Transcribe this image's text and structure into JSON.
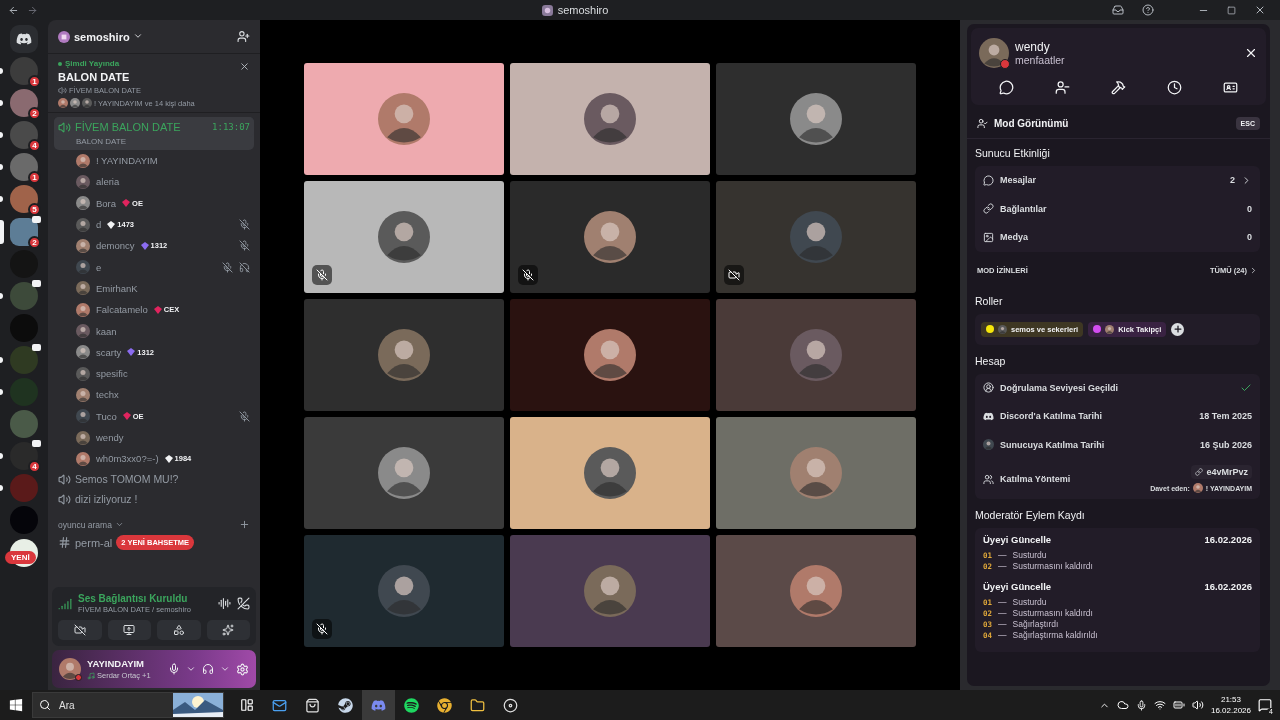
{
  "window": {
    "title": "semoshiro"
  },
  "servers": [
    {
      "unread": true,
      "selected": false,
      "badge": "1",
      "color": "#3c3c3c"
    },
    {
      "unread": true,
      "selected": false,
      "badge": "2",
      "color": "#8a6a70"
    },
    {
      "unread": true,
      "selected": false,
      "badge": "4",
      "color": "#4a4a4a"
    },
    {
      "unread": true,
      "selected": false,
      "badge": "1",
      "color": "#6a6a6a"
    },
    {
      "unread": true,
      "selected": false,
      "badge": "5",
      "color": "#a0634a"
    },
    {
      "unread": false,
      "selected": true,
      "badge": "2",
      "activity": true,
      "color": "#5d7d96"
    },
    {
      "unread": false,
      "selected": false,
      "color": "#141414"
    },
    {
      "unread": true,
      "selected": false,
      "activity": true,
      "color": "#3d4a3a"
    },
    {
      "unread": false,
      "selected": false,
      "color": "#0c0c0c"
    },
    {
      "unread": true,
      "selected": false,
      "activity": true,
      "color": "#2f3a22"
    },
    {
      "unread": true,
      "selected": false,
      "color": "#1f3320"
    },
    {
      "unread": false,
      "selected": false,
      "color": "#4a5a48"
    },
    {
      "unread": true,
      "selected": false,
      "badge": "4",
      "activity": true,
      "color": "#2a2a2a"
    },
    {
      "unread": true,
      "selected": false,
      "color": "#5a1a1a"
    },
    {
      "unread": false,
      "selected": false,
      "color": "#05050a"
    },
    {
      "unread": false,
      "selected": false,
      "pill": "YENİ",
      "color": "#e8efe6"
    }
  ],
  "server": {
    "name": "semoshiro"
  },
  "live": {
    "label": "Şimdi Yayında",
    "title": "BALON DATE",
    "channel": "FİVEM BALON DATE",
    "viewers": "! YAYINDAYIM ve 14 kişi daha"
  },
  "channels": [
    {
      "kind": "voice",
      "name": "FİVEM BALON DATE",
      "selected": true,
      "timer": "1:13:07",
      "status": "BALON DATE",
      "members": [
        {
          "name": "! YAYINDAYIM"
        },
        {
          "name": "aleria"
        },
        {
          "name": "Bora",
          "tag": {
            "text": "OE",
            "color": "#e0245e"
          }
        },
        {
          "name": "d",
          "tag": {
            "text": "1473",
            "color": "#f2f3f5"
          },
          "muted": true
        },
        {
          "name": "demoncy",
          "tag": {
            "text": "1312",
            "color": "#8b6cf0"
          },
          "muted": true
        },
        {
          "name": "e",
          "muted": true,
          "deafened": true
        },
        {
          "name": "EmirhanK"
        },
        {
          "name": "Falcatamelo",
          "tag": {
            "text": "CEX",
            "color": "#e0245e"
          }
        },
        {
          "name": "kaan"
        },
        {
          "name": "scarty",
          "tag": {
            "text": "1312",
            "color": "#8b6cf0"
          }
        },
        {
          "name": "spesific"
        },
        {
          "name": "techx"
        },
        {
          "name": "Tuco",
          "tag": {
            "text": "OE",
            "color": "#e0245e"
          },
          "muted": true
        },
        {
          "name": "wendy"
        },
        {
          "name": "wh0m3xx0?=-)",
          "tag": {
            "text": "1984",
            "color": "#f2f3f5"
          }
        }
      ]
    },
    {
      "kind": "voice",
      "name": "Semos TOMOM MU!?",
      "selected": false
    },
    {
      "kind": "voice",
      "name": "dizi izliyoruz !",
      "selected": false
    },
    {
      "kind": "category",
      "name": "oyuncu arama",
      "selected": false
    },
    {
      "kind": "text",
      "name": "perm-al",
      "selected": false,
      "mention_pill": "2 YENİ BAHSETME"
    }
  ],
  "voice_panel": {
    "status": "Ses Bağlantısı Kuruldu",
    "detail": "FİVEM BALON DATE / semoshiro"
  },
  "user": {
    "name": "YAYINDAYIM",
    "activity": "Serdar Ortaç +1",
    "do_not_disturb": true
  },
  "video_tiles": [
    {
      "color": "#eeaaaf"
    },
    {
      "color": "#c4b2ad"
    },
    {
      "color": "#2e2e2e"
    },
    {
      "color": "#b8b8b8",
      "muted": true
    },
    {
      "color": "#2a2a2a",
      "muted": true
    },
    {
      "color": "#36332f",
      "video_off": true
    },
    {
      "color": "#2e2e2e"
    },
    {
      "color": "#2a1210"
    },
    {
      "color": "#4a3a38"
    },
    {
      "color": "#3a3a3a"
    },
    {
      "color": "#d9b28a"
    },
    {
      "color": "#6e6e66"
    },
    {
      "color": "#1f2a30",
      "muted": true
    },
    {
      "color": "#4a3a50"
    },
    {
      "color": "#5b4a48"
    }
  ],
  "profile": {
    "name": "wendy",
    "subtitle": "menfaatler",
    "do_not_disturb": true
  },
  "mod_view": {
    "title": "Mod Görünümü",
    "key": "ESC"
  },
  "server_activity": {
    "title": "Sunucu Etkinliği",
    "rows": [
      {
        "kind": "messages",
        "label": "Mesajlar",
        "value": "2",
        "link": true
      },
      {
        "kind": "links",
        "label": "Bağlantılar",
        "value": "0"
      },
      {
        "kind": "media",
        "label": "Medya",
        "value": "0"
      }
    ]
  },
  "mod_permissions": {
    "label": "MOD İZİNLERİ",
    "action": "TÜMÜ (24)"
  },
  "roles": {
    "title": "Roller",
    "items": [
      {
        "name": "semos ve sekerleri",
        "color": "#f5e60a"
      },
      {
        "name": "Kick Takipçi",
        "color": "#d24df0"
      }
    ]
  },
  "account": {
    "title": "Hesap",
    "rows": [
      {
        "kind": "verification",
        "label": "Doğrulama Seviyesi Geçildi",
        "verified": true
      },
      {
        "kind": "discord_join",
        "label": "Discord'a Katılma Tarihi",
        "value": "18 Tem 2025"
      },
      {
        "kind": "server_join",
        "label": "Sunucuya Katılma Tarihi",
        "value": "16 Şub 2026"
      },
      {
        "kind": "join_method",
        "label": "Katılma Yöntemi",
        "invite": "e4vMrPvz",
        "inviter_label": "Davet eden:",
        "inviter": "! YAYINDAYIM"
      }
    ]
  },
  "mod_log": {
    "title": "Moderatör Eylem Kaydı",
    "separator": "—",
    "entries": [
      {
        "title": "Üyeyi Güncelle",
        "date": "16.02.2026",
        "actions": [
          {
            "number": "01",
            "text": "Susturdu"
          },
          {
            "number": "02",
            "text": "Susturmasını kaldırdı"
          }
        ]
      },
      {
        "title": "Üyeyi Güncelle",
        "date": "16.02.2026",
        "actions": [
          {
            "number": "01",
            "text": "Susturdu"
          },
          {
            "number": "02",
            "text": "Susturmasını kaldırdı"
          },
          {
            "number": "03",
            "text": "Sağırlaştırdı"
          },
          {
            "number": "04",
            "text": "Sağırlaştırma kaldırıldı"
          }
        ]
      }
    ]
  },
  "taskbar": {
    "search_placeholder": "Ara",
    "time": "21:53",
    "date": "16.02.2026",
    "notifications": "4"
  }
}
